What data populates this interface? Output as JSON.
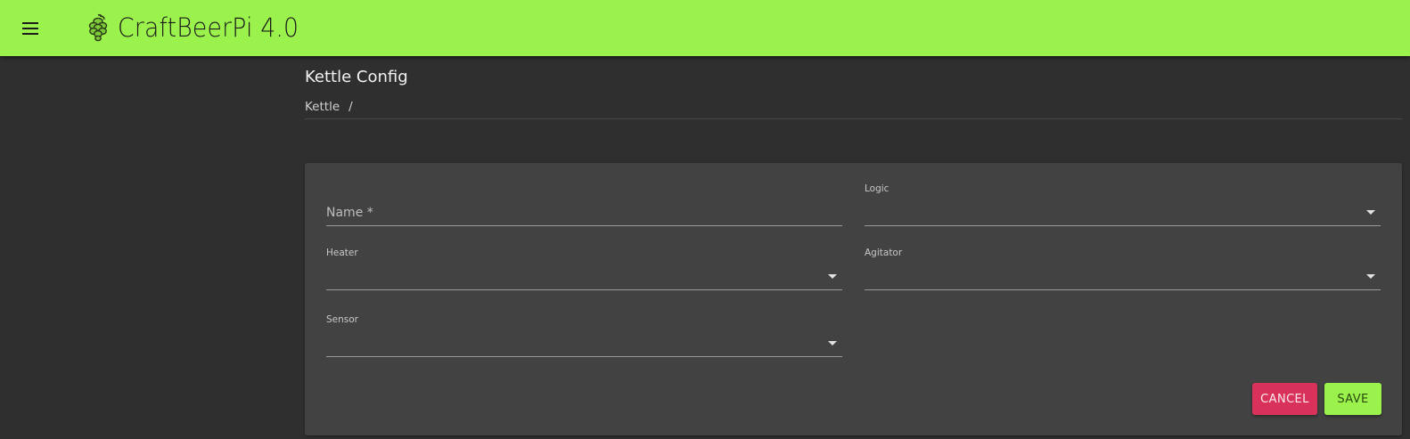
{
  "header": {
    "title": "CraftBeerPi 4.0",
    "menu_icon": "menu-icon",
    "logo_icon": "hop-icon",
    "bg_color": "#9cf24c"
  },
  "page": {
    "title": "Kettle Config",
    "breadcrumb": [
      "Kettle",
      "/"
    ]
  },
  "form": {
    "name": {
      "placeholder": "Name *",
      "value": ""
    },
    "logic": {
      "label": "Logic",
      "value": ""
    },
    "heater": {
      "label": "Heater",
      "value": ""
    },
    "agitator": {
      "label": "Agitator",
      "value": ""
    },
    "sensor": {
      "label": "Sensor",
      "value": ""
    }
  },
  "actions": {
    "cancel_label": "CANCEL",
    "save_label": "SAVE",
    "cancel_color": "#d8325a",
    "save_color": "#9cf24c"
  }
}
